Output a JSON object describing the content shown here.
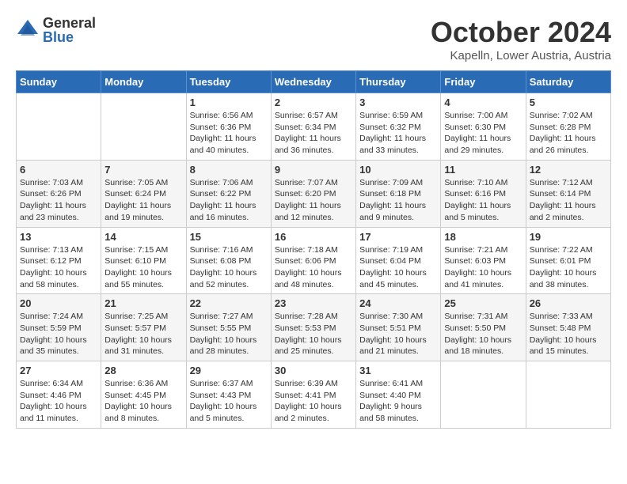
{
  "header": {
    "logo_general": "General",
    "logo_blue": "Blue",
    "month_title": "October 2024",
    "location": "Kapelln, Lower Austria, Austria"
  },
  "weekdays": [
    "Sunday",
    "Monday",
    "Tuesday",
    "Wednesday",
    "Thursday",
    "Friday",
    "Saturday"
  ],
  "weeks": [
    [
      {
        "day": "",
        "info": ""
      },
      {
        "day": "",
        "info": ""
      },
      {
        "day": "1",
        "info": "Sunrise: 6:56 AM\nSunset: 6:36 PM\nDaylight: 11 hours and 40 minutes."
      },
      {
        "day": "2",
        "info": "Sunrise: 6:57 AM\nSunset: 6:34 PM\nDaylight: 11 hours and 36 minutes."
      },
      {
        "day": "3",
        "info": "Sunrise: 6:59 AM\nSunset: 6:32 PM\nDaylight: 11 hours and 33 minutes."
      },
      {
        "day": "4",
        "info": "Sunrise: 7:00 AM\nSunset: 6:30 PM\nDaylight: 11 hours and 29 minutes."
      },
      {
        "day": "5",
        "info": "Sunrise: 7:02 AM\nSunset: 6:28 PM\nDaylight: 11 hours and 26 minutes."
      }
    ],
    [
      {
        "day": "6",
        "info": "Sunrise: 7:03 AM\nSunset: 6:26 PM\nDaylight: 11 hours and 23 minutes."
      },
      {
        "day": "7",
        "info": "Sunrise: 7:05 AM\nSunset: 6:24 PM\nDaylight: 11 hours and 19 minutes."
      },
      {
        "day": "8",
        "info": "Sunrise: 7:06 AM\nSunset: 6:22 PM\nDaylight: 11 hours and 16 minutes."
      },
      {
        "day": "9",
        "info": "Sunrise: 7:07 AM\nSunset: 6:20 PM\nDaylight: 11 hours and 12 minutes."
      },
      {
        "day": "10",
        "info": "Sunrise: 7:09 AM\nSunset: 6:18 PM\nDaylight: 11 hours and 9 minutes."
      },
      {
        "day": "11",
        "info": "Sunrise: 7:10 AM\nSunset: 6:16 PM\nDaylight: 11 hours and 5 minutes."
      },
      {
        "day": "12",
        "info": "Sunrise: 7:12 AM\nSunset: 6:14 PM\nDaylight: 11 hours and 2 minutes."
      }
    ],
    [
      {
        "day": "13",
        "info": "Sunrise: 7:13 AM\nSunset: 6:12 PM\nDaylight: 10 hours and 58 minutes."
      },
      {
        "day": "14",
        "info": "Sunrise: 7:15 AM\nSunset: 6:10 PM\nDaylight: 10 hours and 55 minutes."
      },
      {
        "day": "15",
        "info": "Sunrise: 7:16 AM\nSunset: 6:08 PM\nDaylight: 10 hours and 52 minutes."
      },
      {
        "day": "16",
        "info": "Sunrise: 7:18 AM\nSunset: 6:06 PM\nDaylight: 10 hours and 48 minutes."
      },
      {
        "day": "17",
        "info": "Sunrise: 7:19 AM\nSunset: 6:04 PM\nDaylight: 10 hours and 45 minutes."
      },
      {
        "day": "18",
        "info": "Sunrise: 7:21 AM\nSunset: 6:03 PM\nDaylight: 10 hours and 41 minutes."
      },
      {
        "day": "19",
        "info": "Sunrise: 7:22 AM\nSunset: 6:01 PM\nDaylight: 10 hours and 38 minutes."
      }
    ],
    [
      {
        "day": "20",
        "info": "Sunrise: 7:24 AM\nSunset: 5:59 PM\nDaylight: 10 hours and 35 minutes."
      },
      {
        "day": "21",
        "info": "Sunrise: 7:25 AM\nSunset: 5:57 PM\nDaylight: 10 hours and 31 minutes."
      },
      {
        "day": "22",
        "info": "Sunrise: 7:27 AM\nSunset: 5:55 PM\nDaylight: 10 hours and 28 minutes."
      },
      {
        "day": "23",
        "info": "Sunrise: 7:28 AM\nSunset: 5:53 PM\nDaylight: 10 hours and 25 minutes."
      },
      {
        "day": "24",
        "info": "Sunrise: 7:30 AM\nSunset: 5:51 PM\nDaylight: 10 hours and 21 minutes."
      },
      {
        "day": "25",
        "info": "Sunrise: 7:31 AM\nSunset: 5:50 PM\nDaylight: 10 hours and 18 minutes."
      },
      {
        "day": "26",
        "info": "Sunrise: 7:33 AM\nSunset: 5:48 PM\nDaylight: 10 hours and 15 minutes."
      }
    ],
    [
      {
        "day": "27",
        "info": "Sunrise: 6:34 AM\nSunset: 4:46 PM\nDaylight: 10 hours and 11 minutes."
      },
      {
        "day": "28",
        "info": "Sunrise: 6:36 AM\nSunset: 4:45 PM\nDaylight: 10 hours and 8 minutes."
      },
      {
        "day": "29",
        "info": "Sunrise: 6:37 AM\nSunset: 4:43 PM\nDaylight: 10 hours and 5 minutes."
      },
      {
        "day": "30",
        "info": "Sunrise: 6:39 AM\nSunset: 4:41 PM\nDaylight: 10 hours and 2 minutes."
      },
      {
        "day": "31",
        "info": "Sunrise: 6:41 AM\nSunset: 4:40 PM\nDaylight: 9 hours and 58 minutes."
      },
      {
        "day": "",
        "info": ""
      },
      {
        "day": "",
        "info": ""
      }
    ]
  ]
}
